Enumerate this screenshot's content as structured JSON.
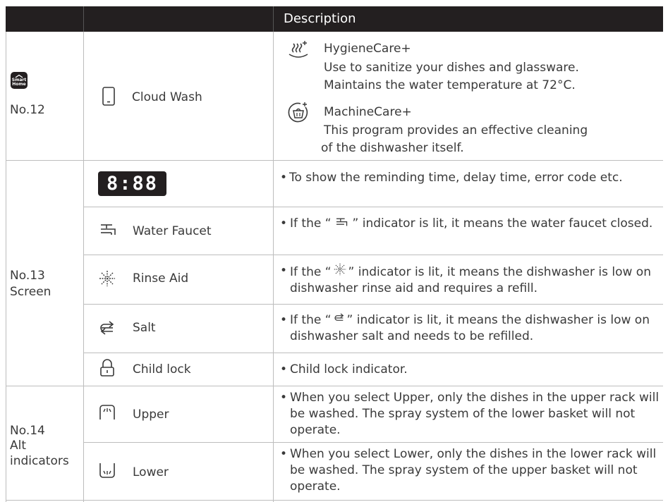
{
  "header": {
    "description": "Description"
  },
  "rows": {
    "no12": {
      "label": "No.12",
      "badge_line1": "Smart",
      "badge_line2": "Home",
      "feature": "Cloud Wash",
      "program1_title": "HygieneCare+",
      "program1_line1": "Use to sanitize your dishes and glassware.",
      "program1_line2": "Maintains the water temperature at 72°C.",
      "program2_title": "MachineCare+",
      "program2_line1": "This program provides an effective cleaning",
      "program2_line2": "of the dishwasher itself."
    },
    "no13": {
      "label_line1": "No.13",
      "label_line2": "Screen",
      "display_digits": "8:88",
      "display_desc": "To show the reminding time, delay time, error code etc.",
      "faucet": "Water Faucet",
      "faucet_desc_a": "If the “",
      "faucet_desc_b": "” indicator is lit, it means the water faucet closed.",
      "rinse": "Rinse Aid",
      "rinse_desc_a": "If the “",
      "rinse_desc_b": "” indicator is lit,  it means the dishwasher is low on dishwasher rinse aid and requires a refill.",
      "salt": "Salt",
      "salt_desc_a": "If the “",
      "salt_desc_b": "” indicator is lit, it means the dishwasher is low on dishwasher salt and needs to be refilled.",
      "child": "Child lock",
      "child_desc": "Child lock indicator."
    },
    "no14": {
      "label_line1": "No.14",
      "label_line2": "Alt",
      "label_line3": "indicators",
      "upper": "Upper",
      "upper_desc": "When you select Upper, only the dishes in the upper rack will be washed. The spray system of the lower basket will not operate.",
      "lower": "Lower",
      "lower_desc": "When you select Lower, only the dishes in the lower rack will be washed. The spray system of the upper basket will not operate."
    }
  },
  "icons": {
    "smart_home": "smart-home-icon",
    "phone": "phone-icon",
    "steam": "hygiene-steam-icon",
    "machine": "machine-care-icon",
    "faucet": "faucet-icon",
    "rinse": "rinse-aid-icon",
    "salt": "salt-icon",
    "lock": "lock-icon",
    "upper": "upper-rack-icon",
    "lower": "lower-rack-icon"
  },
  "colors": {
    "header_bg": "#231f20",
    "header_text": "#ffffff",
    "grid": "#bdbdbd",
    "text": "#3a3a3a",
    "display_bg": "#231f20"
  }
}
